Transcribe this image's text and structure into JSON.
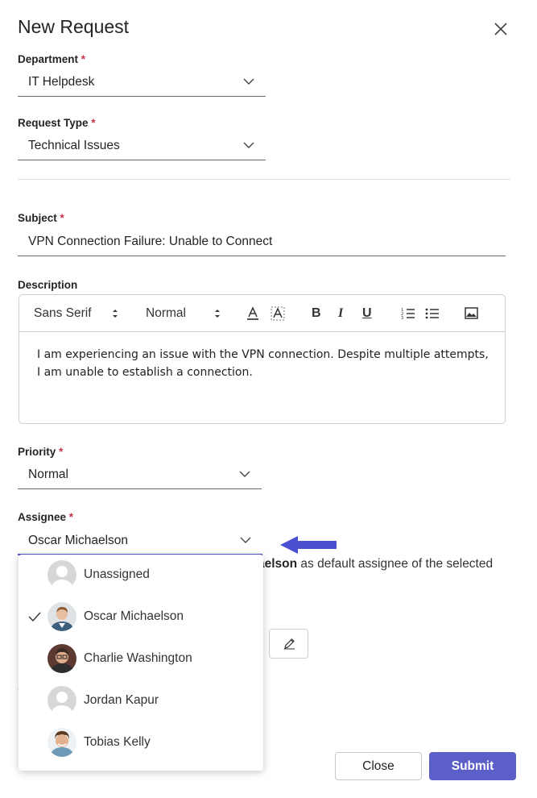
{
  "dialog": {
    "title": "New Request",
    "required_mark": "*"
  },
  "department": {
    "label": "Department",
    "value": "IT Helpdesk"
  },
  "request_type": {
    "label": "Request Type",
    "value": "Technical Issues"
  },
  "subject": {
    "label": "Subject",
    "value": "VPN Connection Failure: Unable to Connect"
  },
  "description": {
    "label": "Description",
    "toolbar": {
      "font_family": "Sans Serif",
      "font_size": "Normal",
      "bold": "B",
      "italic": "I",
      "underline": "U"
    },
    "text": "I am experiencing an issue with the VPN connection. Despite multiple attempts, I am unable to establish a connection."
  },
  "priority": {
    "label": "Priority",
    "value": "Normal"
  },
  "assignee": {
    "label": "Assignee",
    "value": "Oscar Michaelson",
    "hint_bold": "aelson",
    "hint_rest": " as default assignee of the selected",
    "options": [
      {
        "name": "Unassigned",
        "selected": false,
        "avatar": "placeholder"
      },
      {
        "name": "Oscar Michaelson",
        "selected": true,
        "avatar": "photo"
      },
      {
        "name": "Charlie Washington",
        "selected": false,
        "avatar": "photo"
      },
      {
        "name": "Jordan Kapur",
        "selected": false,
        "avatar": "placeholder"
      },
      {
        "name": "Tobias Kelly",
        "selected": false,
        "avatar": "photo"
      }
    ]
  },
  "actions": {
    "close": "Close",
    "submit": "Submit"
  },
  "colors": {
    "accent": "#5b5fc7",
    "focus_underline": "#4f4fc9",
    "required": "#c4314b",
    "annotation_arrow": "#4a4fd1"
  }
}
